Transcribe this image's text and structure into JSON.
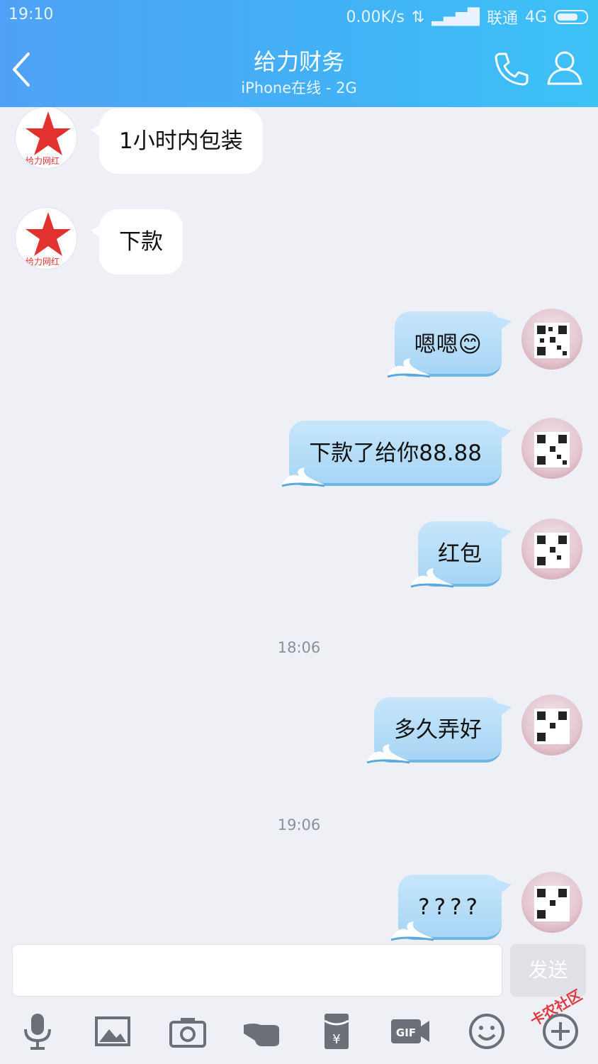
{
  "status_bar": {
    "time": "19:10",
    "speed": "0.00K/s",
    "carrier": "联通",
    "network": "4G"
  },
  "header": {
    "title": "给力财务",
    "subtitle": "iPhone在线 - 2G"
  },
  "messages": [
    {
      "side": "left",
      "text": "1小时内包装"
    },
    {
      "side": "left",
      "text": "下款"
    },
    {
      "side": "right",
      "text": "嗯嗯",
      "emoji": "😊"
    },
    {
      "side": "right",
      "text": "下款了给你88.88"
    },
    {
      "side": "right",
      "text": "红包"
    },
    {
      "side": "time",
      "text": "18:06"
    },
    {
      "side": "right",
      "text": "多久弄好"
    },
    {
      "side": "time",
      "text": "19:06"
    },
    {
      "side": "right",
      "text": "????"
    }
  ],
  "contact_avatar_text": "给力网红",
  "input": {
    "placeholder": "",
    "send_label": "发送"
  },
  "toolbar": [
    "mic-icon",
    "image-icon",
    "camera-icon",
    "poke-icon",
    "red-packet-icon",
    "gif-icon",
    "emoji-icon",
    "plus-icon"
  ],
  "watermark": "卡农社区",
  "colors": {
    "header_start": "#4fa2f6",
    "header_end": "#3dc2f6",
    "bubble_right": "#b8dcf8",
    "background": "#eef0f6"
  }
}
